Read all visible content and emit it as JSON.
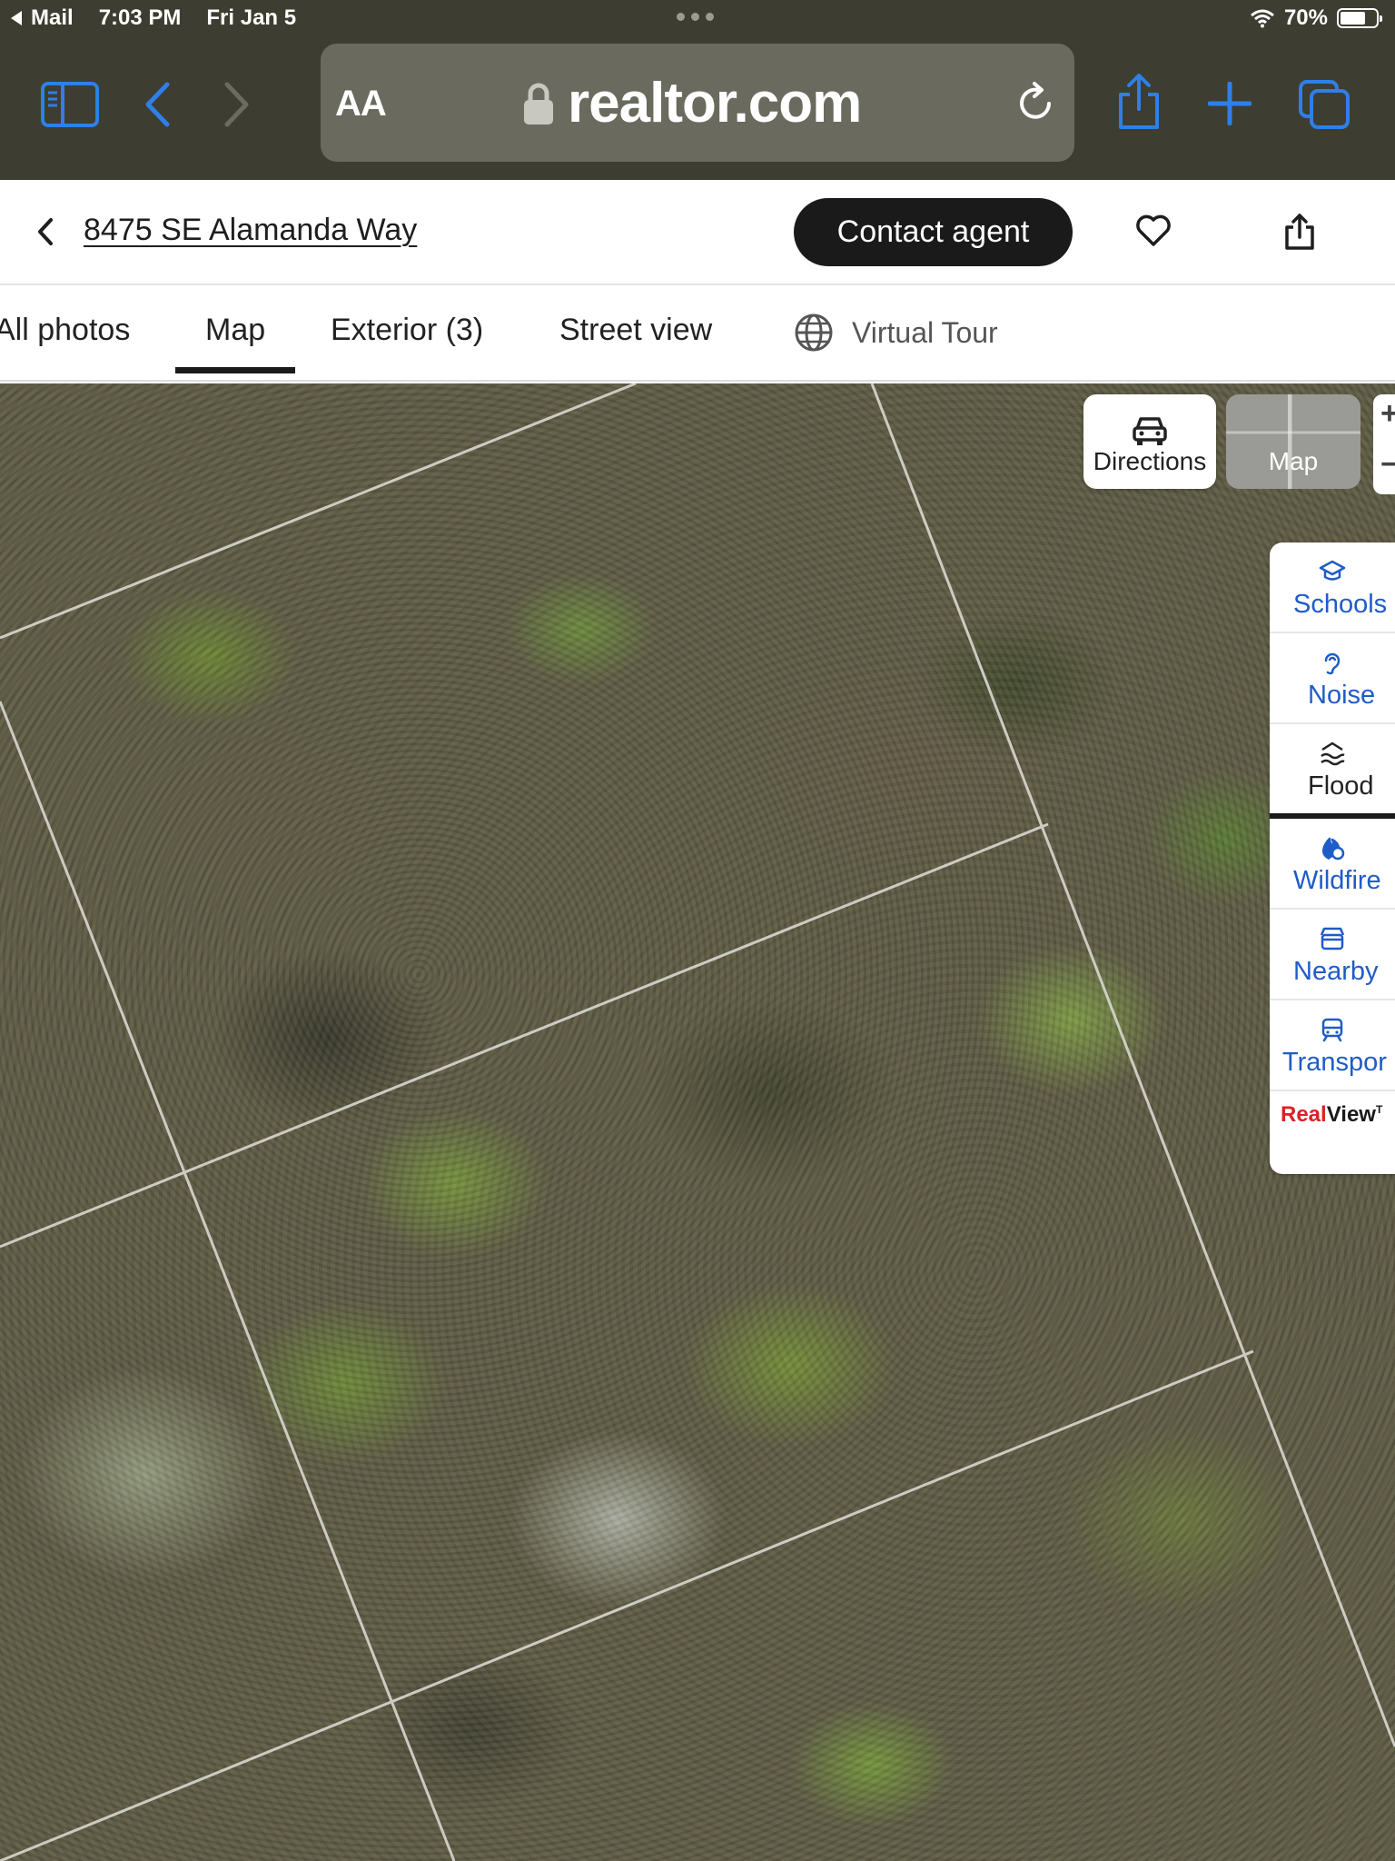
{
  "status_bar": {
    "back_app": "Mail",
    "time": "7:03 PM",
    "date": "Fri Jan 5",
    "battery_percent": "70%",
    "battery_level": 0.7
  },
  "browser": {
    "text_size_label": "AA",
    "url": "realtor.com",
    "icons": [
      "sidebar-icon",
      "back-icon",
      "forward-icon",
      "lock-icon",
      "reload-icon",
      "share-icon",
      "new-tab-icon",
      "tabs-icon"
    ]
  },
  "listing_header": {
    "address": "8475 SE Alamanda Way",
    "contact_button": "Contact agent"
  },
  "media_tabs": [
    {
      "label": "All photos",
      "active": false
    },
    {
      "label": "Map",
      "active": true
    },
    {
      "label": "Exterior (3)",
      "active": false
    },
    {
      "label": "Street view",
      "active": false
    },
    {
      "label": "Virtual Tour",
      "active": false
    }
  ],
  "map": {
    "view": "satellite",
    "directions_label": "Directions",
    "map_type_label": "Map",
    "layers": [
      {
        "label": "Schools",
        "icon": "school-icon"
      },
      {
        "label": "Noise",
        "icon": "noise-icon"
      },
      {
        "label": "Flood",
        "icon": "flood-icon",
        "active": true
      },
      {
        "label": "Wildfire",
        "icon": "wildfire-icon"
      },
      {
        "label": "Nearby",
        "icon": "nearby-icon"
      },
      {
        "label": "Transpor",
        "icon": "transport-icon"
      }
    ],
    "realview": {
      "part1": "Real",
      "part2": "View",
      "mark": "T"
    }
  },
  "colors": {
    "browser_bg": "#3d3d31",
    "accent_blue": "#1f5cc7",
    "safari_blue": "#2f7fe8",
    "brand_red": "#d92228",
    "button_dark": "#1a1a1a"
  }
}
